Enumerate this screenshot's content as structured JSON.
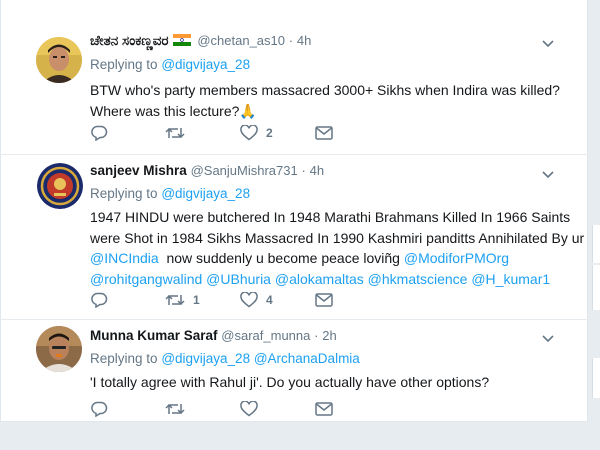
{
  "tweets": [
    {
      "name": "ಚೇತನ ಸಂಕಣ್ಣವರ",
      "handle": "@chetan_as10",
      "time": "4h",
      "reply_prefix": "Replying to",
      "reply_mentions": "@digvijaya_28",
      "lines": [
        "BTW who's party members massacred 3000+ Sikhs when Indira was killed?",
        "Where was this lecture?🙏"
      ],
      "retweets": "",
      "likes": "2"
    },
    {
      "name": "sanjeev Mishra",
      "handle": "@SanjuMishra731",
      "time": "4h",
      "reply_prefix": "Replying to",
      "reply_mentions": "@digvijaya_28",
      "line1": "1947 HINDU were butchered In 1948 Marathi Brahmans Killed In 1966 Saints",
      "line2": "were Shot in 1984 Sikhs Massacred In 1990 Kashmiri panditts Annihilated By ur",
      "line3_a": "@INCIndia",
      "line3_b": "  now suddenly u become peace loviñg ",
      "line3_c": "@ModiforPMOrg",
      "line4": "@rohitgangwalind @UBhuria @alokamaltas @hkmatscience @H_kumar1",
      "retweets": "1",
      "likes": "4"
    },
    {
      "name": "Munna Kumar Saraf",
      "handle": "@saraf_munna",
      "time": "2h",
      "reply_prefix": "Replying to",
      "reply_mentions": "@digvijaya_28 @ArchanaDalmia",
      "lines": [
        "'I totally agree with Rahul ji'. Do you actually have other options?"
      ],
      "retweets": "",
      "likes": ""
    }
  ],
  "colors": {
    "link": "#1da1f2",
    "secondary": "#657786",
    "text": "#14171a",
    "border": "#e6ecf0"
  },
  "icons": [
    "reply-icon",
    "retweet-icon",
    "like-icon",
    "message-icon",
    "chevron-down-icon",
    "india-flag-icon"
  ]
}
